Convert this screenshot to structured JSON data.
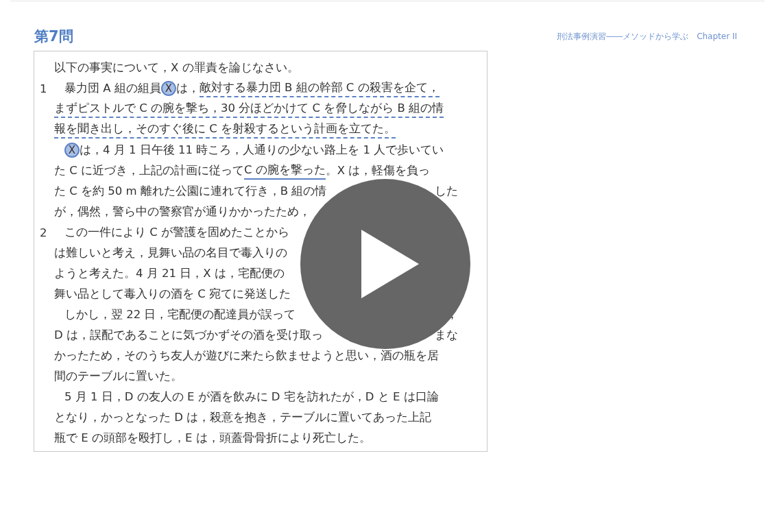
{
  "header": {
    "title": "第7問",
    "book_title": "刑法事例演習――メソッドから学ぶ　Chapter II"
  },
  "document": {
    "lines": [
      {
        "indent": false,
        "left": [
          {
            "kind": "plain",
            "text": "以下の事実について，X の罪責を論じなさい。"
          }
        ]
      },
      {
        "number": "1",
        "indent": true,
        "left": [
          {
            "kind": "plain",
            "text": "暴力団 A 組の組員"
          },
          {
            "kind": "circled",
            "text": "X"
          },
          {
            "kind": "plain",
            "text": "は，"
          },
          {
            "kind": "dashed",
            "text": "敵対する暴力団 B 組の幹部 C の殺害を企て，"
          }
        ]
      },
      {
        "indent": false,
        "left": [
          {
            "kind": "dashed",
            "text": "まずピストルで C の腕を撃ち，30 分ほどかけて C を脅しながら B 組の情"
          }
        ]
      },
      {
        "indent": false,
        "left": [
          {
            "kind": "dashed",
            "text": "報を聞き出し，そのすぐ後に C を射殺するという計画を立てた。"
          }
        ]
      },
      {
        "indent": true,
        "left": [
          {
            "kind": "circled",
            "text": "X"
          },
          {
            "kind": "plain",
            "text": "は，4 月 1 日午後 11 時ころ，人通りの少ない路上を 1 人で歩いてい"
          }
        ]
      },
      {
        "indent": false,
        "left": [
          {
            "kind": "plain",
            "text": "た C に近づき，上記の計画に従って "
          },
          {
            "kind": "solid",
            "text": "C の腕を撃った"
          },
          {
            "kind": "plain",
            "text": "。X は，軽傷を負っ"
          }
        ]
      },
      {
        "indent": false,
        "left": [
          {
            "kind": "plain",
            "text": "た C を約 50 m 離れた公園に連れて行き，B 組の情"
          }
        ],
        "right": [
          {
            "kind": "plain",
            "text": "した"
          }
        ]
      },
      {
        "indent": false,
        "left": [
          {
            "kind": "plain",
            "text": "が，偶然，警ら中の警察官が通りかかったため，"
          }
        ]
      },
      {
        "number": "2",
        "indent": true,
        "left": [
          {
            "kind": "plain",
            "text": "この一件により C が警護を固めたことから"
          }
        ]
      },
      {
        "indent": false,
        "left": [
          {
            "kind": "plain",
            "text": "は難しいと考え，見舞い品の名目で毒入りの"
          }
        ]
      },
      {
        "indent": false,
        "left": [
          {
            "kind": "plain",
            "text": "ようと考えた。4 月 21 日，X は，宅配便の"
          }
        ]
      },
      {
        "indent": false,
        "left": [
          {
            "kind": "plain",
            "text": "舞い品として毒入りの酒を C 宛てに発送した"
          }
        ]
      },
      {
        "indent": true,
        "left": [
          {
            "kind": "plain",
            "text": "しかし，翌 22 日，宅配便の配達員が誤って"
          }
        ],
        "right": [
          {
            "kind": "plain",
            "text": "，"
          }
        ]
      },
      {
        "indent": false,
        "left": [
          {
            "kind": "plain",
            "text": "D は，誤配であることに気づかずその酒を受け取っ"
          }
        ],
        "right": [
          {
            "kind": "plain",
            "text": "まな"
          }
        ]
      },
      {
        "indent": false,
        "left": [
          {
            "kind": "plain",
            "text": "かったため，そのうち友人が遊びに来たら飲ませようと思い，酒の瓶を居"
          }
        ]
      },
      {
        "indent": false,
        "left": [
          {
            "kind": "plain",
            "text": "間のテーブルに置いた。"
          }
        ]
      },
      {
        "indent": true,
        "left": [
          {
            "kind": "plain",
            "text": "5 月 1 日，D の友人の E が酒を飲みに D 宅を訪れたが，D と E は口論"
          }
        ]
      },
      {
        "indent": false,
        "left": [
          {
            "kind": "plain",
            "text": "となり，かっとなった D は，殺意を抱き，テーブルに置いてあった上記"
          }
        ]
      },
      {
        "indent": false,
        "left": [
          {
            "kind": "plain",
            "text": "瓶で E の頭部を殴打し，E は，頭蓋骨骨折により死亡した。"
          }
        ]
      }
    ]
  }
}
